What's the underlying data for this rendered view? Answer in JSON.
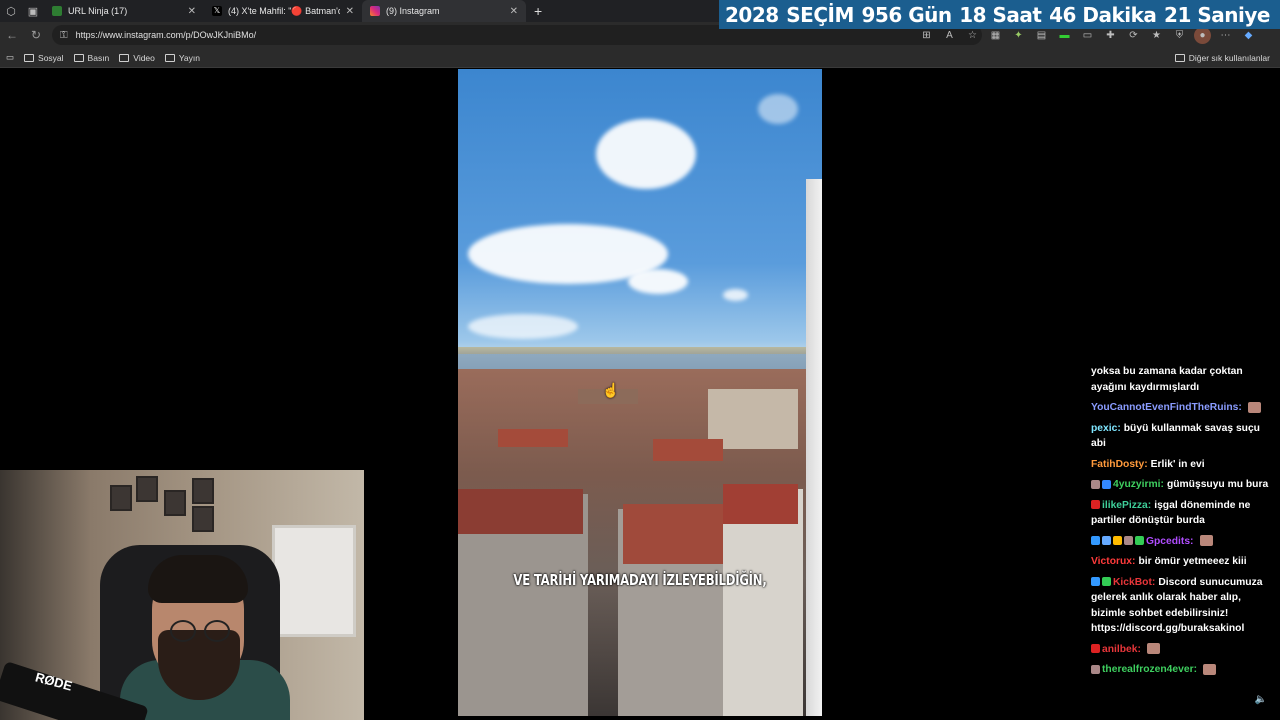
{
  "tabs": [
    {
      "title": "URL Ninja (17)",
      "favicon_color": "#2e7d32"
    },
    {
      "title": "(4) X'te Mahfil: \"🔴 Batman'da ha",
      "favicon_color": "#000000"
    },
    {
      "title": "(9) Instagram",
      "favicon_color": "#d62976",
      "active": true
    }
  ],
  "new_tab_symbol": "+",
  "countdown": {
    "year": "2028",
    "label": "SEÇİM",
    "days": "956 Gün",
    "hours": "18 Saat",
    "minutes": "46 Dakika",
    "seconds": "21 Saniye",
    "background": "#1b5e8f"
  },
  "toolbar": {
    "url": "https://www.instagram.com/p/DOwJKJniBMo/"
  },
  "bookmarks": {
    "items": [
      "Sosyal",
      "Basın",
      "Video",
      "Yayın"
    ],
    "other": "Diğer sık kullanılanlar"
  },
  "video": {
    "subtitle": "VE TARİHİ YARIMADAYI İZLEYEBİLDİĞİN,"
  },
  "webcam": {
    "mic_brand": "RØDE"
  },
  "chat": {
    "messages": [
      {
        "user": "",
        "color": "#ffffff",
        "text": "yoksa bu zamana kadar çoktan ayağını kaydırmışlardı"
      },
      {
        "user": "YouCannotEvenFindTheRuins:",
        "color": "#8a9cff",
        "text": ""
      },
      {
        "user": "pexic:",
        "color": "#7fe6ff",
        "text": "büyü kullanmak savaş suçu abi"
      },
      {
        "user": "FatihDosty:",
        "color": "#ff9a3c",
        "text": "Erlik' in evi"
      },
      {
        "user": "4yuzyirmi:",
        "color": "#3ecf5f",
        "text": "gümüşsuyu mu bura"
      },
      {
        "user": "ilikePizza:",
        "color": "#3ecf9a",
        "text": "işgal döneminde ne partiler dönüştür burda"
      },
      {
        "user": "Gpcedits:",
        "color": "#b04dff",
        "text": ""
      },
      {
        "user": "Victorux:",
        "color": "#ff3b3b",
        "text": "bir ömür yetmeeez kiii"
      },
      {
        "user": "KickBot:",
        "color": "#e8363a",
        "text": "Discord sunucumuza gelerek anlık olarak haber alıp, bizimle sohbet edebilirsiniz! https://discord.gg/buraksakinol"
      },
      {
        "user": "anilbek:",
        "color": "#e8363a",
        "text": ""
      },
      {
        "user": "therealfrozen4ever:",
        "color": "#3ecf5f",
        "text": ""
      }
    ]
  }
}
